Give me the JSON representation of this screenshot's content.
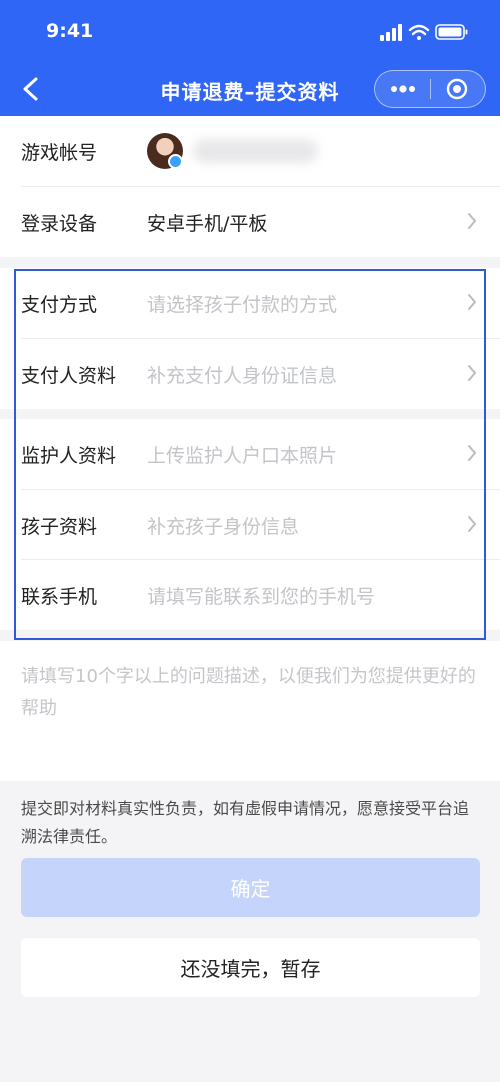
{
  "status_bar": {
    "time": "9:41",
    "icons": [
      "signal-icon",
      "wifi-icon",
      "battery-icon"
    ]
  },
  "nav": {
    "title": "申请退费–提交资料",
    "back_icon": "back-arrow-icon",
    "more_icon": "more-dots-icon",
    "close_icon": "target-icon"
  },
  "account": {
    "label": "游戏帐号",
    "device_label": "登录设备",
    "device_value": "安卓手机/平板"
  },
  "form": {
    "payment_method": {
      "label": "支付方式",
      "placeholder": "请选择孩子付款的方式"
    },
    "payer_info": {
      "label": "支付人资料",
      "placeholder": "补充支付人身份证信息"
    },
    "guardian_info": {
      "label": "监护人资料",
      "placeholder": "上传监护人户口本照片"
    },
    "child_info": {
      "label": "孩子资料",
      "placeholder": "补充孩子身份信息"
    },
    "phone": {
      "label": "联系手机",
      "placeholder": "请填写能联系到您的手机号"
    }
  },
  "description": {
    "placeholder": "请填写10个字以上的问题描述，以便我们为您提供更好的帮助"
  },
  "notice": "提交即对材料真实性负责，如有虚假申请情况，愿意接受平台追溯法律责任。",
  "buttons": {
    "confirm": "确定",
    "save_draft": "还没填完，暂存"
  },
  "colors": {
    "primary": "#2f66f5",
    "confirm_disabled": "#c4d4fb",
    "highlight": "#2e59d9",
    "placeholder": "#c2c4c8"
  }
}
